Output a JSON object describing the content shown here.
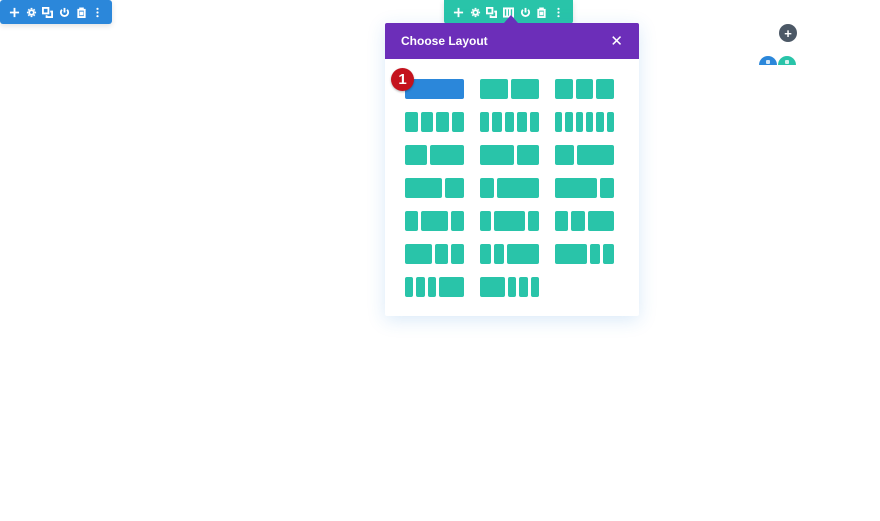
{
  "section_toolbar": {
    "color": "#2b87da",
    "buttons": [
      "move-icon",
      "settings-icon",
      "duplicate-icon",
      "power-icon",
      "trash-icon",
      "more-icon"
    ]
  },
  "row_toolbar": {
    "color": "#29c4a9",
    "buttons": [
      "move-icon",
      "settings-icon",
      "duplicate-icon",
      "columns-icon",
      "power-icon",
      "trash-icon",
      "more-icon"
    ]
  },
  "modal": {
    "title": "Choose Layout",
    "close_label": "✕",
    "header_color": "#6c2eb9",
    "layouts": [
      {
        "name": "1",
        "cols": [
          1
        ],
        "selected": true
      },
      {
        "name": "1/2 1/2",
        "cols": [
          1,
          1
        ]
      },
      {
        "name": "1/3 1/3 1/3",
        "cols": [
          1,
          1,
          1
        ]
      },
      {
        "name": "1/4 x4",
        "cols": [
          1,
          1,
          1,
          1
        ]
      },
      {
        "name": "1/5 x5",
        "cols": [
          1,
          1,
          1,
          1,
          1
        ]
      },
      {
        "name": "1/6 x6",
        "cols": [
          1,
          1,
          1,
          1,
          1,
          1
        ]
      },
      {
        "name": "2/5 3/5",
        "cols": [
          2,
          3
        ]
      },
      {
        "name": "3/5 2/5",
        "cols": [
          3,
          2
        ]
      },
      {
        "name": "1/3 2/3",
        "cols": [
          1,
          2
        ]
      },
      {
        "name": "2/3 1/3",
        "cols": [
          2,
          1
        ]
      },
      {
        "name": "1/4 3/4",
        "cols": [
          1,
          3
        ]
      },
      {
        "name": "3/4 1/4",
        "cols": [
          3,
          1
        ]
      },
      {
        "name": "1/4 1/2 1/4",
        "cols": [
          1,
          2,
          1
        ]
      },
      {
        "name": "1/5 3/5 1/5",
        "cols": [
          1,
          3,
          1
        ]
      },
      {
        "name": "1/4 1/4 1/2",
        "cols": [
          1,
          1,
          2
        ]
      },
      {
        "name": "1/2 1/4 1/4",
        "cols": [
          2,
          1,
          1
        ]
      },
      {
        "name": "1/5 1/5 3/5",
        "cols": [
          1,
          1,
          3
        ]
      },
      {
        "name": "3/5 1/5 1/5",
        "cols": [
          3,
          1,
          1
        ]
      },
      {
        "name": "1/6 1/6 1/6 1/2",
        "cols": [
          1,
          1,
          1,
          3
        ]
      },
      {
        "name": "1/2 1/6 1/6 1/6",
        "cols": [
          3,
          1,
          1,
          1
        ]
      }
    ]
  },
  "badge": {
    "label": "1",
    "color": "#c4121d"
  },
  "add_button": {
    "label": "+"
  },
  "colors": {
    "accent_blue": "#2b87da",
    "accent_green": "#29c4a9",
    "dark": "#4c5866"
  }
}
